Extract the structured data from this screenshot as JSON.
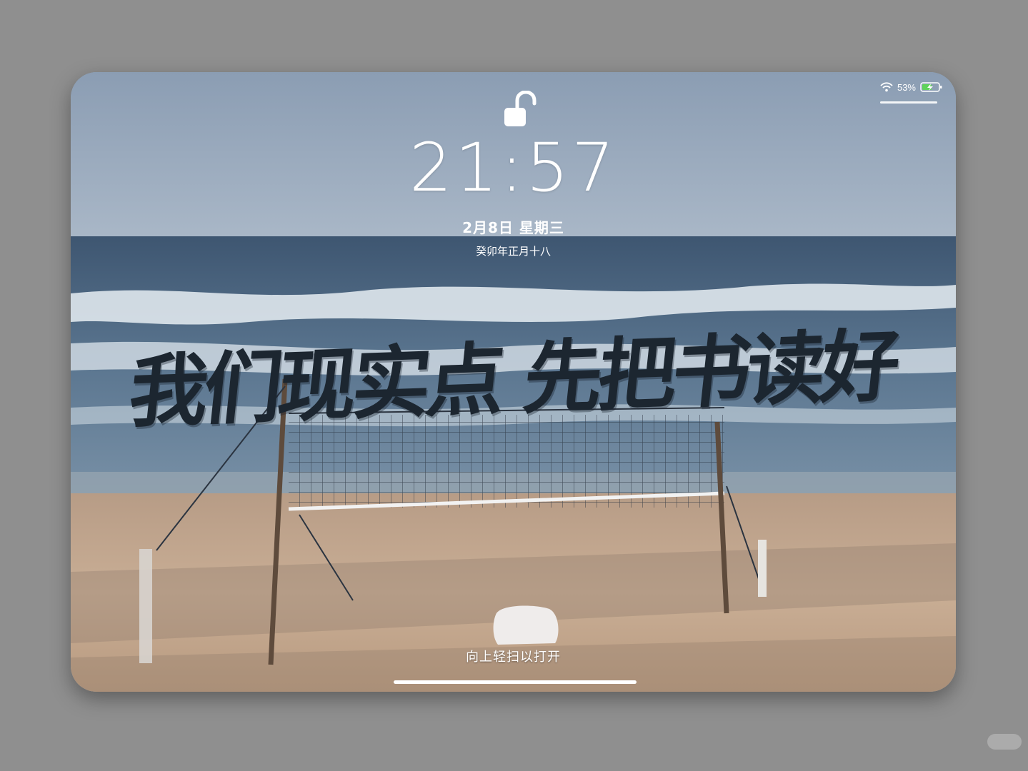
{
  "status_bar": {
    "wifi_icon": "wifi-icon",
    "battery_percent": "53%",
    "battery_icon": "battery-charging-icon"
  },
  "lock_screen": {
    "lock_icon": "unlocked-padlock-icon",
    "time": "21:57",
    "date": "2月8日 星期三",
    "lunar_date": "癸卯年正月十八",
    "wallpaper_text": "我们现实点 先把书读好",
    "swipe_hint": "向上轻扫以打开"
  },
  "colors": {
    "background": "#8f8f8f",
    "sky": "#8da0b4",
    "sea": "#4f6a84",
    "sand": "#c3a890",
    "calligraphy": "#1c2630"
  }
}
